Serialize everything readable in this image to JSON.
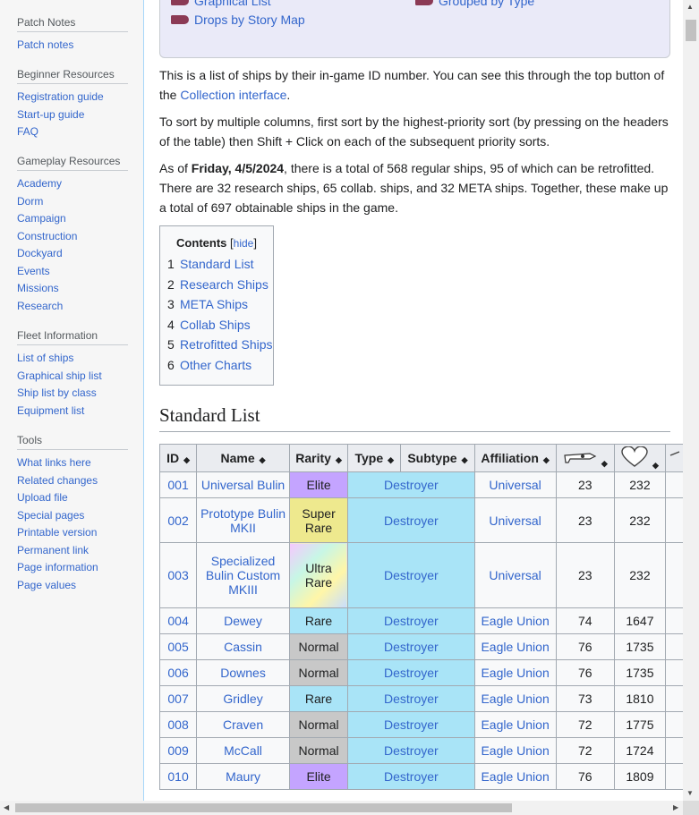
{
  "sidebar": {
    "sections": [
      {
        "heading": "Patch Notes",
        "items": [
          "Patch notes"
        ]
      },
      {
        "heading": "Beginner Resources",
        "items": [
          "Registration guide",
          "Start-up guide",
          "FAQ"
        ]
      },
      {
        "heading": "Gameplay Resources",
        "items": [
          "Academy",
          "Dorm",
          "Campaign",
          "Construction",
          "Dockyard",
          "Events",
          "Missions",
          "Research"
        ]
      },
      {
        "heading": "Fleet Information",
        "items": [
          "List of ships",
          "Graphical ship list",
          "Ship list by class",
          "Equipment list"
        ]
      },
      {
        "heading": "Tools",
        "items": [
          "What links here",
          "Related changes",
          "Upload file",
          "Special pages",
          "Printable version",
          "Permanent link",
          "Page information",
          "Page values"
        ]
      }
    ]
  },
  "navbox": {
    "items": [
      "Graphical List",
      "Grouped by Type",
      "Drops by Story Map"
    ]
  },
  "intro": {
    "p1_text": "This is a list of ships by their in-game ID number. You can see this through the top button of the ",
    "p1_link": "Collection interface",
    "p1_end": ".",
    "p2": "To sort by multiple columns, first sort by the highest-priority sort (by pressing on the headers of the table) then Shift + Click on each of the subsequent priority sorts.",
    "p3_start": "As of ",
    "p3_bold": "Friday, 4/5/2024",
    "p3_rest": ", there is a total of 568 regular ships, 95 of which can be retrofitted. There are 32 research ships, 65 collab. ships, and 32 META ships. Together, these make up a total of 697 obtainable ships in the game."
  },
  "toc": {
    "title": "Contents",
    "hide_open": "[",
    "hide": "hide",
    "hide_close": "]",
    "items": [
      {
        "num": "1",
        "label": "Standard List"
      },
      {
        "num": "2",
        "label": "Research Ships"
      },
      {
        "num": "3",
        "label": "META Ships"
      },
      {
        "num": "4",
        "label": "Collab Ships"
      },
      {
        "num": "5",
        "label": "Retrofitted Ships"
      },
      {
        "num": "6",
        "label": "Other Charts"
      }
    ]
  },
  "section_title": "Standard List",
  "table": {
    "headers": [
      "ID",
      "Name",
      "Rarity",
      "Type",
      "Subtype",
      "Affiliation"
    ],
    "icon_headers": [
      "firepower-icon",
      "health-heart-icon"
    ],
    "rows": [
      {
        "id": "001",
        "name": "Universal Bulin",
        "rarity": "Elite",
        "type": "Destroyer",
        "affiliation": "Universal",
        "stat1": "23",
        "stat2": "232"
      },
      {
        "id": "002",
        "name": "Prototype Bulin MKII",
        "rarity": "Super Rare",
        "type": "Destroyer",
        "affiliation": "Universal",
        "stat1": "23",
        "stat2": "232"
      },
      {
        "id": "003",
        "name": "Specialized Bulin Custom MKIII",
        "rarity": "Ultra Rare",
        "type": "Destroyer",
        "affiliation": "Universal",
        "stat1": "23",
        "stat2": "232"
      },
      {
        "id": "004",
        "name": "Dewey",
        "rarity": "Rare",
        "type": "Destroyer",
        "affiliation": "Eagle Union",
        "stat1": "74",
        "stat2": "1647"
      },
      {
        "id": "005",
        "name": "Cassin",
        "rarity": "Normal",
        "type": "Destroyer",
        "affiliation": "Eagle Union",
        "stat1": "76",
        "stat2": "1735"
      },
      {
        "id": "006",
        "name": "Downes",
        "rarity": "Normal",
        "type": "Destroyer",
        "affiliation": "Eagle Union",
        "stat1": "76",
        "stat2": "1735"
      },
      {
        "id": "007",
        "name": "Gridley",
        "rarity": "Rare",
        "type": "Destroyer",
        "affiliation": "Eagle Union",
        "stat1": "73",
        "stat2": "1810"
      },
      {
        "id": "008",
        "name": "Craven",
        "rarity": "Normal",
        "type": "Destroyer",
        "affiliation": "Eagle Union",
        "stat1": "72",
        "stat2": "1775"
      },
      {
        "id": "009",
        "name": "McCall",
        "rarity": "Normal",
        "type": "Destroyer",
        "affiliation": "Eagle Union",
        "stat1": "72",
        "stat2": "1724"
      },
      {
        "id": "010",
        "name": "Maury",
        "rarity": "Elite",
        "type": "Destroyer",
        "affiliation": "Eagle Union",
        "stat1": "76",
        "stat2": "1809"
      }
    ]
  },
  "colors": {
    "link": "#3366cc",
    "elite": "#c4a4ff",
    "super_rare": "#eee98e",
    "rare": "#a9e4f7",
    "normal": "#c8c8c8"
  }
}
